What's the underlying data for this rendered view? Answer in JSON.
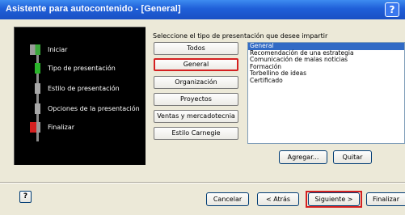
{
  "window": {
    "title": "Asistente para autocontenido - [General]",
    "help_glyph": "?"
  },
  "steps": [
    {
      "label": "Iniciar",
      "state": "start"
    },
    {
      "label": "Tipo de presentación",
      "state": "current"
    },
    {
      "label": "Estilo de presentación",
      "state": "pending"
    },
    {
      "label": "Opciones de la presentación",
      "state": "pending"
    },
    {
      "label": "Finalizar",
      "state": "finish"
    }
  ],
  "instruction": "Seleccione el tipo de presentación que desee impartir",
  "categories": [
    {
      "label": "Todos",
      "selected": false
    },
    {
      "label": "General",
      "selected": true
    },
    {
      "label": "Organización",
      "selected": false
    },
    {
      "label": "Proyectos",
      "selected": false
    },
    {
      "label": "Ventas y mercadotecnia",
      "selected": false
    },
    {
      "label": "Estilo Carnegie",
      "selected": false
    }
  ],
  "presentation_types": [
    {
      "label": "General",
      "selected": true
    },
    {
      "label": "Recomendación de una estrategia",
      "selected": false
    },
    {
      "label": "Comunicación de malas noticias",
      "selected": false
    },
    {
      "label": "Formación",
      "selected": false
    },
    {
      "label": "Torbellino de ideas",
      "selected": false
    },
    {
      "label": "Certificado",
      "selected": false
    }
  ],
  "list_buttons": {
    "add": "Agregar...",
    "remove": "Quitar"
  },
  "footer": {
    "help_glyph": "?",
    "cancel": "Cancelar",
    "back": "< Atrás",
    "next": "Siguiente >",
    "finish": "Finalizar"
  },
  "colors": {
    "titlebar": "#1f5fd8",
    "highlight_border": "#d42020",
    "list_selection": "#316ac5",
    "step_current": "#2bb52b"
  }
}
